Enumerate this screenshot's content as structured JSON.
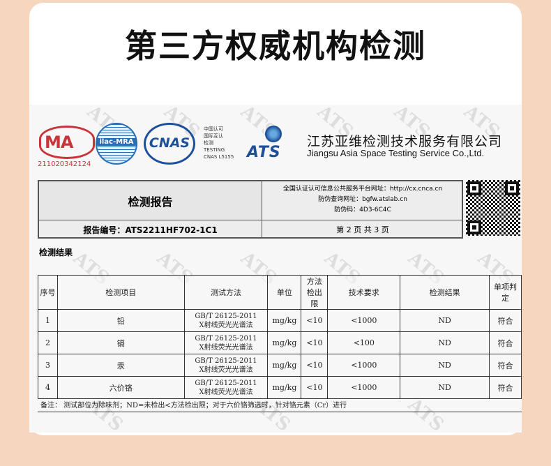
{
  "heading": "第三方权威机构检测",
  "logos": {
    "cma_text": "MA",
    "cma_number": "211020342124",
    "ilac_text": "ilac-MRA",
    "cnas_text": "CNAS",
    "cnas_side_lines": [
      "中国认可",
      "国际互认",
      "检测",
      "TESTING",
      "CNAS L5155"
    ],
    "ats_text": "ATS",
    "company_cn": "江苏亚维检测技术服务有限公司",
    "company_en": "Jiangsu Asia Space Testing Service Co.,Ltd."
  },
  "report": {
    "title": "检测报告",
    "number": "报告编号：ATS2211HF702-1C1",
    "info_line1": "全国认证认可信息公共服务平台网址：http://cx.cnca.cn",
    "info_line2": "防伪查询网址：bgfw.atslab.cn",
    "info_line3": "防伪码：4D3-6C4C",
    "page": "第 2 页 共 3 页"
  },
  "results_label": "检测结果",
  "table": {
    "headers": {
      "no": "序号",
      "item": "检测项目",
      "method": "测试方法",
      "unit": "单位",
      "limit": "方法检出限",
      "requirement": "技术要求",
      "result": "检测结果",
      "verdict": "单项判定"
    },
    "rows": [
      {
        "no": "1",
        "item": "铅",
        "method1": "GB/T 26125-2011",
        "method2": "X射线荧光光谱法",
        "unit": "mg/kg",
        "limit": "<10",
        "requirement": "<1000",
        "result": "ND",
        "verdict": "符合"
      },
      {
        "no": "2",
        "item": "镉",
        "method1": "GB/T 26125-2011",
        "method2": "X射线荧光光谱法",
        "unit": "mg/kg",
        "limit": "<10",
        "requirement": "<100",
        "result": "ND",
        "verdict": "符合"
      },
      {
        "no": "3",
        "item": "汞",
        "method1": "GB/T 26125-2011",
        "method2": "X射线荧光光谱法",
        "unit": "mg/kg",
        "limit": "<10",
        "requirement": "<1000",
        "result": "ND",
        "verdict": "符合"
      },
      {
        "no": "4",
        "item": "六价铬",
        "method1": "GB/T 26125-2011",
        "method2": "X射线荧光光谱法",
        "unit": "mg/kg",
        "limit": "<10",
        "requirement": "<1000",
        "result": "ND",
        "verdict": "符合"
      }
    ]
  },
  "note": "备注：    测试部位为除味剂；ND=未检出<方法检出限；对于六价铬筛选时，针对铬元素（Cr）进行",
  "watermark": "ATS",
  "colors": {
    "background": "#f6d6bf",
    "cma_red": "#c8343a",
    "cnas_blue": "#1d4f9a"
  }
}
